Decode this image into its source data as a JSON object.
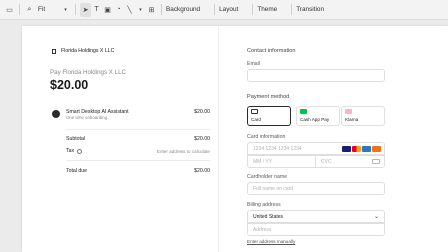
{
  "toolbar": {
    "zoom": "Fit",
    "background": "Background",
    "layout": "Layout",
    "theme": "Theme",
    "transition": "Transition"
  },
  "merchant": {
    "name": "Florida Holdings X LLC"
  },
  "summary": {
    "pay_label": "Pay Florida Holdings X LLC",
    "amount": "$20.00",
    "item_name": "Smart Desktop AI Assistant",
    "item_sub": "One time onboarding",
    "item_price": "$20.00",
    "subtotal_label": "Subtotal",
    "subtotal_value": "$20.00",
    "tax_label": "Tax",
    "tax_value": "Enter address to calculate",
    "total_label": "Total due",
    "total_value": "$20.00"
  },
  "contact": {
    "heading": "Contact information",
    "email_label": "Email"
  },
  "payment": {
    "heading": "Payment method",
    "methods": [
      "Card",
      "Cash App Pay",
      "Klarna"
    ],
    "card_info_label": "Card information",
    "card_number_placeholder": "1234 1234 1234 1234",
    "expiry_placeholder": "MM / YY",
    "cvc_placeholder": "CVC",
    "cardholder_label": "Cardholder name",
    "cardholder_placeholder": "Full name on card",
    "billing_label": "Billing address",
    "country": "United States",
    "address_placeholder": "Address",
    "manual_link": "Enter address manually"
  },
  "colors": {
    "cash_app": "#00c244",
    "klarna": "#ffb3c7",
    "visa": "#1a1f71",
    "mastercard_red": "#eb001b",
    "mastercard_orange": "#f79e1b",
    "amex": "#2e77bc"
  }
}
